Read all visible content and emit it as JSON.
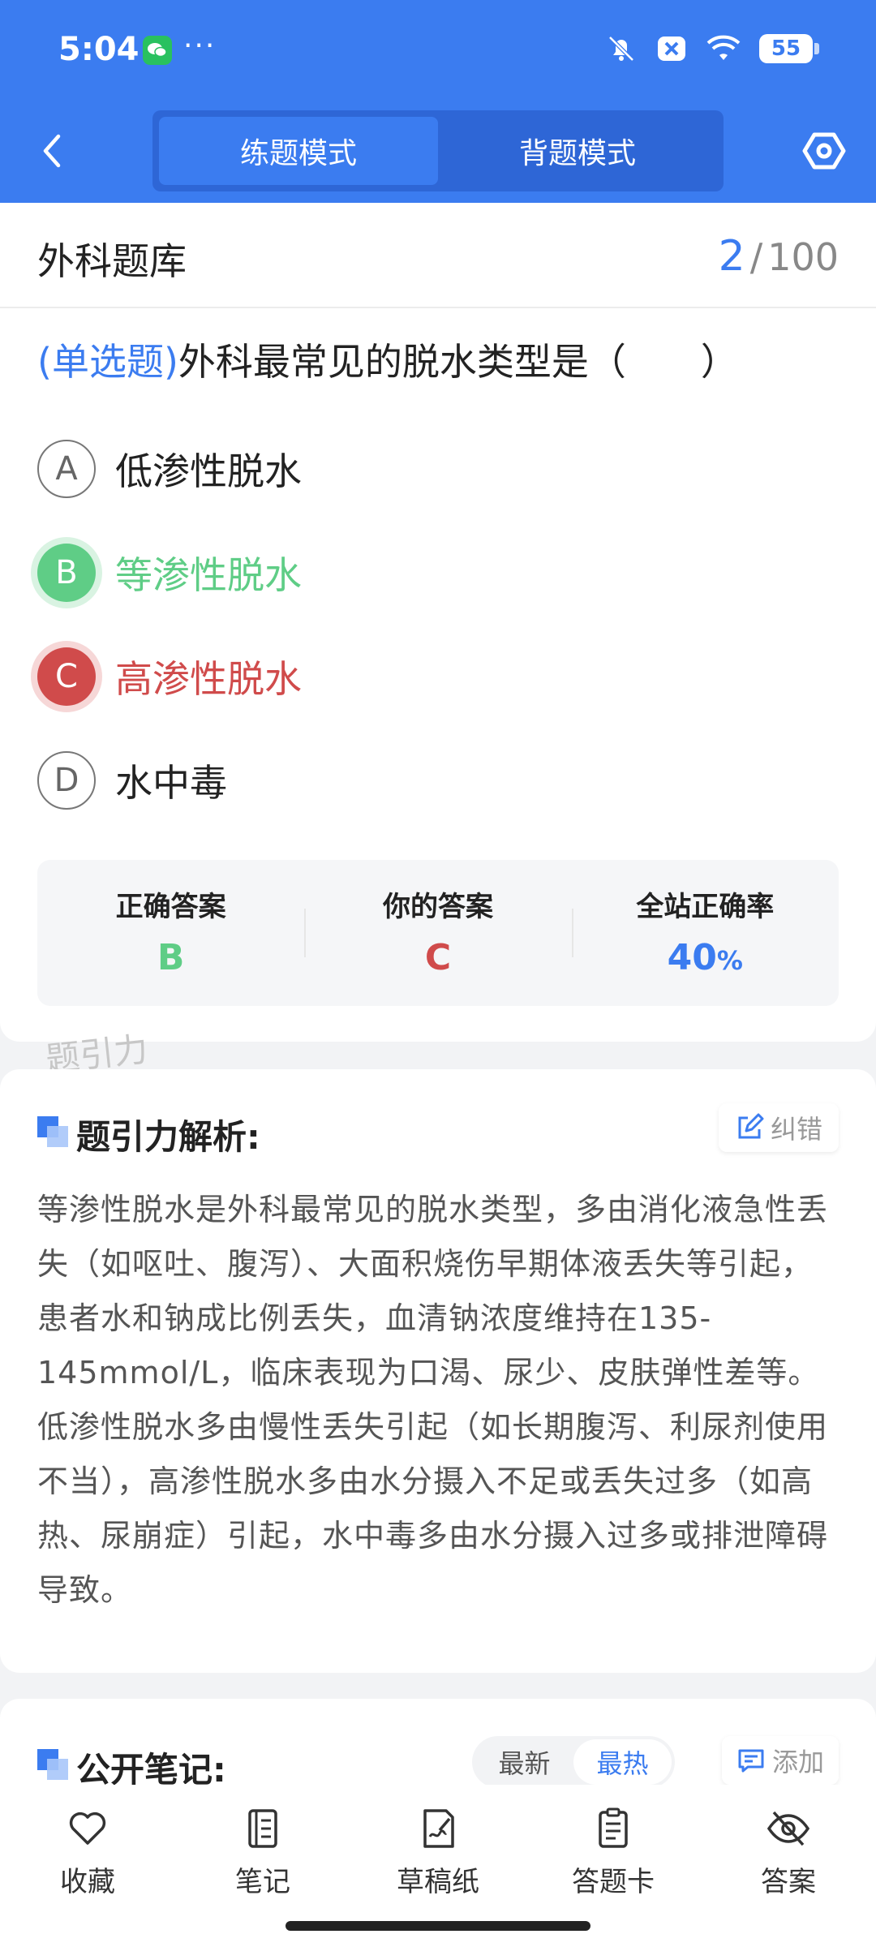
{
  "status_bar": {
    "time": "5:04",
    "dots": "···",
    "battery": "55",
    "icons": [
      "wechat-icon",
      "mute-bell-icon",
      "x-icon",
      "wifi-icon",
      "battery-icon"
    ]
  },
  "header": {
    "modes": [
      {
        "label": "练题模式",
        "active": true
      },
      {
        "label": "背题模式",
        "active": false
      }
    ],
    "accent_color": "#3b7cf0"
  },
  "question": {
    "bank_title": "外科题库",
    "current": "2",
    "separator": "/",
    "total": "100",
    "type_label": "(单选题)",
    "text": "外科最常见的脱水类型是（　　）",
    "options": [
      {
        "letter": "A",
        "text": "低渗性脱水",
        "state": "normal"
      },
      {
        "letter": "B",
        "text": "等渗性脱水",
        "state": "correct"
      },
      {
        "letter": "C",
        "text": "高渗性脱水",
        "state": "wrong"
      },
      {
        "letter": "D",
        "text": "水中毒",
        "state": "normal"
      }
    ]
  },
  "answer_summary": {
    "correct_label": "正确答案",
    "correct_value": "B",
    "your_label": "你的答案",
    "your_value": "C",
    "rate_label": "全站正确率",
    "rate_value": "40",
    "rate_unit": "%"
  },
  "watermark": "题引力",
  "analysis": {
    "title": "题引力解析:",
    "fix_label": "纠错",
    "text": "等渗性脱水是外科最常见的脱水类型，多由消化液急性丢失（如呕吐、腹泻）、大面积烧伤早期体液丢失等引起，患者水和钠成比例丢失，血清钠浓度维持在135-145mmol/L，临床表现为口渴、尿少、皮肤弹性差等。低渗性脱水多由慢性丢失引起（如长期腹泻、利尿剂使用不当），高渗性脱水多由水分摄入不足或丢失过多（如高热、尿崩症）引起，水中毒多由水分摄入过多或排泄障碍导致。"
  },
  "notes": {
    "title": "公开笔记:",
    "sort_latest": "最新",
    "sort_hot": "最热",
    "add_label": "添加"
  },
  "bottom_nav": [
    {
      "label": "收藏",
      "icon": "heart-icon"
    },
    {
      "label": "笔记",
      "icon": "notebook-icon"
    },
    {
      "label": "草稿纸",
      "icon": "draft-paper-icon"
    },
    {
      "label": "答题卡",
      "icon": "answer-card-icon"
    },
    {
      "label": "答案",
      "icon": "eye-off-icon"
    }
  ]
}
